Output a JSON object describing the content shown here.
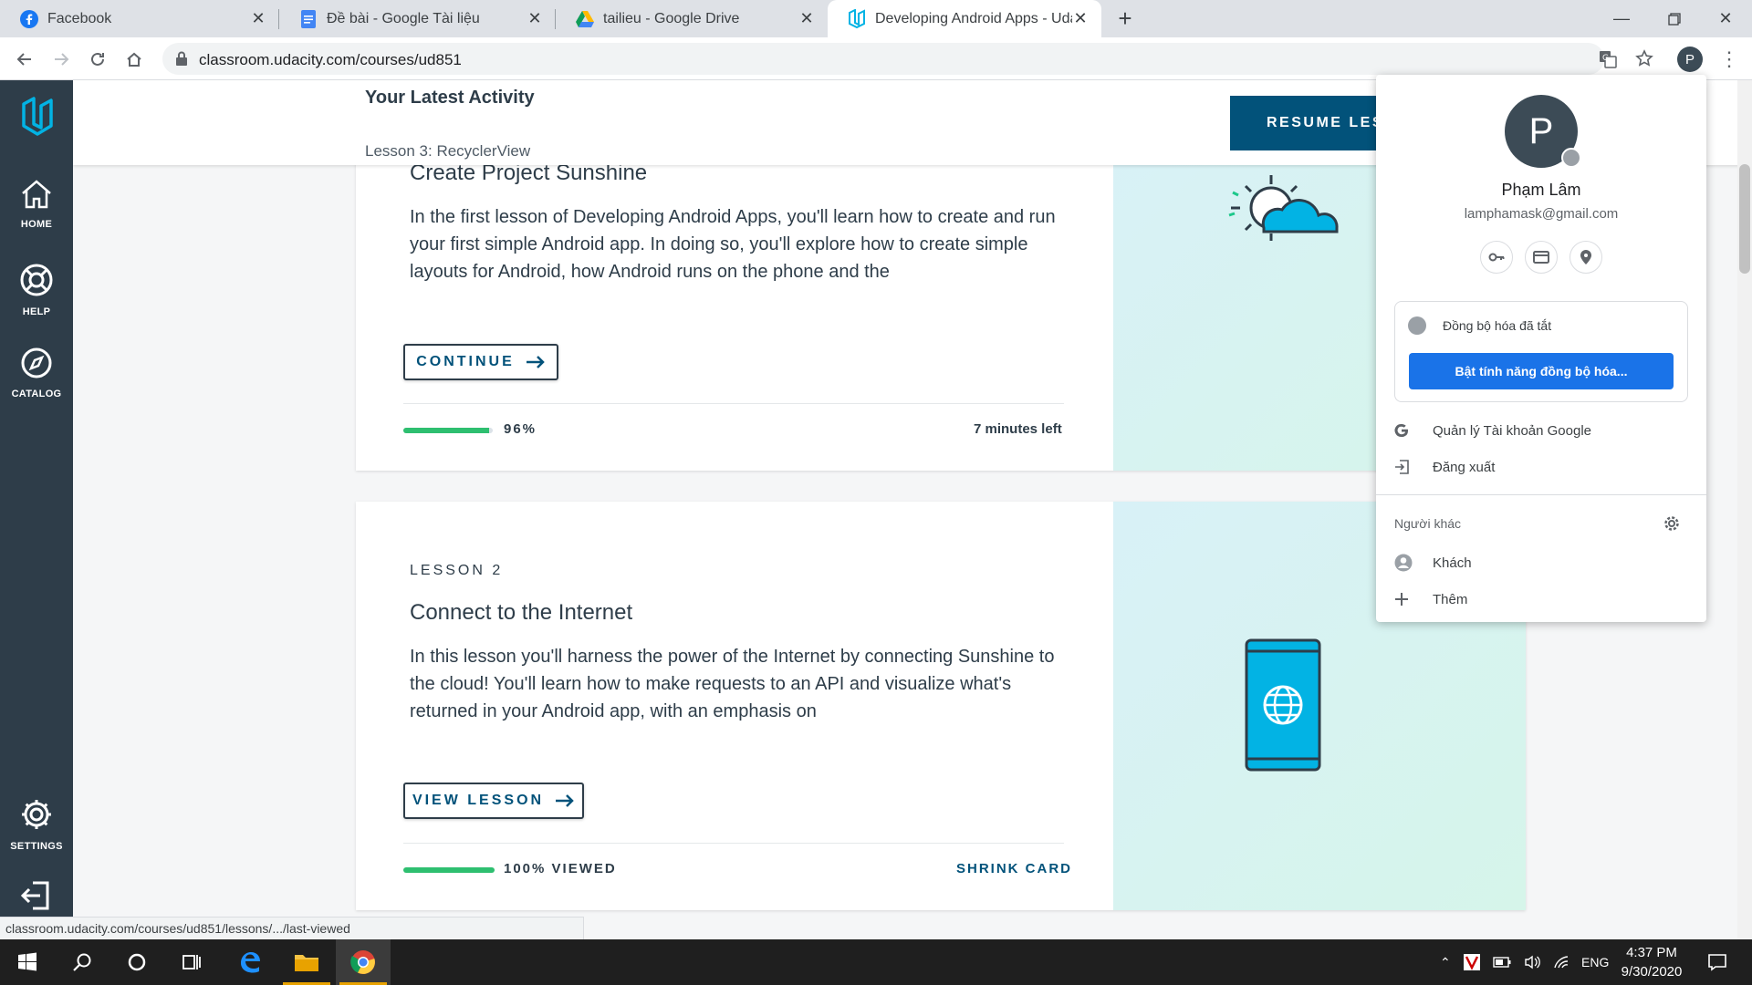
{
  "browser": {
    "tabs": [
      {
        "title": "Facebook"
      },
      {
        "title": "Đề bài - Google Tài liệu"
      },
      {
        "title": "tailieu - Google Drive"
      },
      {
        "title": "Developing Android Apps - Udac"
      }
    ],
    "url": "classroom.udacity.com/courses/ud851",
    "profile_initial": "P",
    "status_url": "classroom.udacity.com/courses/ud851/lessons/.../last-viewed"
  },
  "sidebar": {
    "items": [
      {
        "label": "HOME"
      },
      {
        "label": "HELP"
      },
      {
        "label": "CATALOG"
      },
      {
        "label": "SETTINGS"
      }
    ]
  },
  "activity": {
    "title": "Your Latest Activity",
    "subtitle": "Lesson 3: RecyclerView",
    "resume_label": "RESUME LESSON"
  },
  "lessons": [
    {
      "title": "Create Project Sunshine",
      "description": "In the first lesson of Developing Android Apps, you'll learn how to create and run your first simple Android app. In doing so, you'll explore how to create simple layouts for Android, how Android runs on the phone and the",
      "button": "CONTINUE",
      "progress": 0.96,
      "progress_label": "96%",
      "meta": "7 minutes left"
    },
    {
      "kicker": "LESSON 2",
      "title": "Connect to the Internet",
      "description": "In this lesson you'll harness the power of the Internet by connecting Sunshine to the cloud! You'll learn how to make requests to an API and visualize what's returned in your Android app, with an emphasis on",
      "button": "VIEW LESSON",
      "progress": 1.0,
      "progress_label": "100% VIEWED",
      "meta": "SHRINK CARD"
    }
  ],
  "profile_popup": {
    "initial": "P",
    "name": "Phạm Lâm",
    "email": "lamphamask@gmail.com",
    "sync_status": "Đồng bộ hóa đã tắt",
    "sync_button": "Bật tính năng đồng bộ hóa...",
    "manage_account": "Quản lý Tài khoản Google",
    "sign_out": "Đăng xuất",
    "others_label": "Người khác",
    "guest": "Khách",
    "add": "Thêm"
  },
  "taskbar": {
    "language": "ENG",
    "time": "4:37 PM",
    "date": "9/30/2020"
  },
  "colors": {
    "udacity_dark": "#2e3d49",
    "udacity_blue": "#02527a",
    "progress_green": "#2ebf70",
    "chrome_blue": "#1a73e8"
  }
}
